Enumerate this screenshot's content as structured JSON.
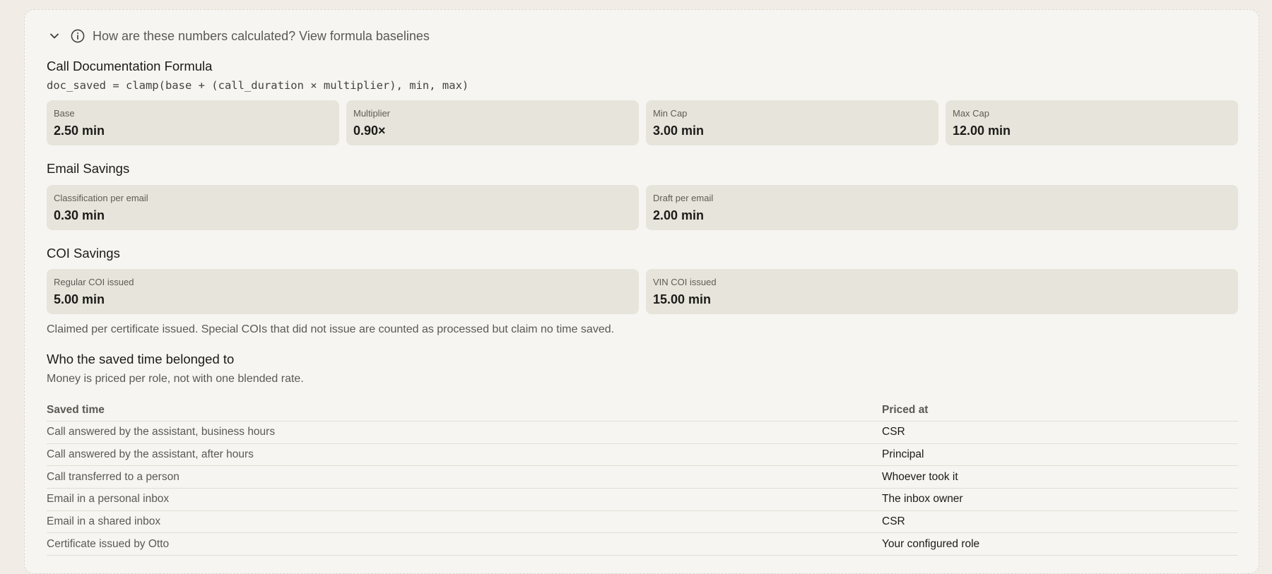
{
  "toggle": {
    "label": "How are these numbers calculated? View formula baselines"
  },
  "call_doc": {
    "title": "Call Documentation Formula",
    "formula": "doc_saved = clamp(base + (call_duration × multiplier), min, max)",
    "cards": [
      {
        "label": "Base",
        "value": "2.50 min"
      },
      {
        "label": "Multiplier",
        "value": "0.90×"
      },
      {
        "label": "Min Cap",
        "value": "3.00 min"
      },
      {
        "label": "Max Cap",
        "value": "12.00 min"
      }
    ]
  },
  "email": {
    "title": "Email Savings",
    "cards": [
      {
        "label": "Classification per email",
        "value": "0.30 min"
      },
      {
        "label": "Draft per email",
        "value": "2.00 min"
      }
    ]
  },
  "coi": {
    "title": "COI Savings",
    "cards": [
      {
        "label": "Regular COI issued",
        "value": "5.00 min"
      },
      {
        "label": "VIN COI issued",
        "value": "15.00 min"
      }
    ],
    "note": "Claimed per certificate issued. Special COIs that did not issue are counted as processed but claim no time saved."
  },
  "roles": {
    "title": "Who the saved time belonged to",
    "subtitle": "Money is priced per role, not with one blended rate.",
    "headers": [
      "Saved time",
      "Priced at"
    ],
    "rows": [
      [
        "Call answered by the assistant, business hours",
        "CSR"
      ],
      [
        "Call answered by the assistant, after hours",
        "Principal"
      ],
      [
        "Call transferred to a person",
        "Whoever took it"
      ],
      [
        "Email in a personal inbox",
        "The inbox owner"
      ],
      [
        "Email in a shared inbox",
        "CSR"
      ],
      [
        "Certificate issued by Otto",
        "Your configured role"
      ]
    ]
  }
}
